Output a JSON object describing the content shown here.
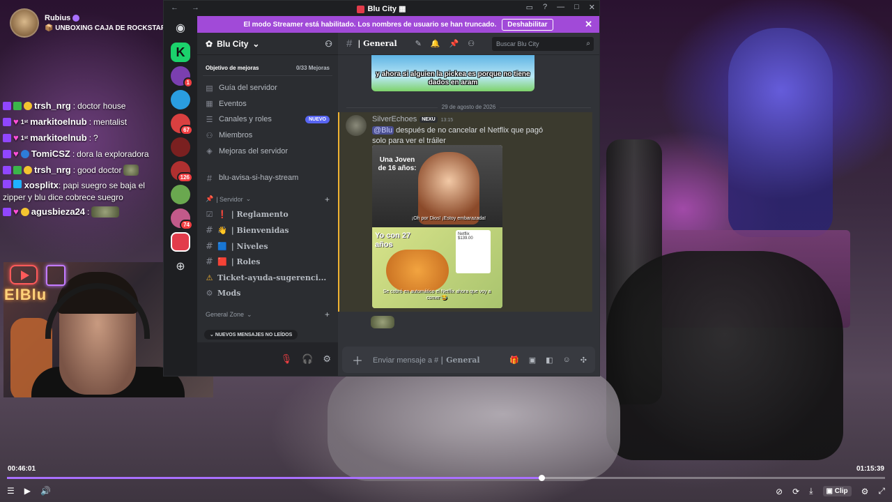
{
  "stream": {
    "streamer_name": "Rubius",
    "stream_title": "📦 UNBOXING CAJA DE ROCKSTAR 📦 N",
    "neon_sign": "ElBlu",
    "time_elapsed": "00:46:01",
    "time_total": "01:15:39",
    "progress": 0.609,
    "clip_label": "Clip"
  },
  "chat": [
    {
      "user": "trsh_nrg",
      "text": "doctor house",
      "user_color": "#ffffff"
    },
    {
      "user": "markitoelnub",
      "text": "mentalist",
      "user_color": "#ffffff"
    },
    {
      "user": "markitoelnub",
      "text": "?",
      "user_color": "#ffffff"
    },
    {
      "user": "TomiCSZ",
      "text": "dora la exploradora",
      "user_color": "#ffffff"
    },
    {
      "user": "trsh_nrg",
      "text": "good doctor",
      "user_color": "#ffffff"
    },
    {
      "user": "xosplitx",
      "text": "papi suegro se baja el zipper y blu dice cobrece suegro",
      "user_color": "#ffffff"
    },
    {
      "user": "agusbieza24",
      "text": "",
      "user_color": "#ffffff"
    }
  ],
  "discord": {
    "window_title": "Blu City",
    "streamer_banner": "El modo Streamer está habilitado. Los nombres de usuario se han truncado.",
    "disable_label": "Deshabilitar",
    "server_name": "Blu City",
    "boost_label": "Objetivo de mejoras",
    "boost_count": "0/33 Mejoras",
    "nav": [
      {
        "label": "Guía del servidor",
        "icon": "guide-icon"
      },
      {
        "label": "Eventos",
        "icon": "calendar-icon"
      },
      {
        "label": "Canales y roles",
        "icon": "channels-roles-icon",
        "badge": "NUEVO"
      },
      {
        "label": "Miembros",
        "icon": "members-icon"
      },
      {
        "label": "Mejoras del servidor",
        "icon": "boost-icon"
      }
    ],
    "loose_channel": "blu-avisa-si-hay-stream",
    "category_server": "| Servidor",
    "channels": [
      {
        "emoji": "❗",
        "name": "| Reglamento",
        "icon": "rules-icon"
      },
      {
        "emoji": "👋",
        "name": "| Bienvenidas",
        "icon": "hash-icon"
      },
      {
        "emoji": "🟦",
        "name": "| Niveles",
        "icon": "hash-icon"
      },
      {
        "emoji": "🟥",
        "name": "| Roles",
        "icon": "hash-icon"
      },
      {
        "emoji": "",
        "name": "Ticket-ayuda-sugerenci...",
        "icon": "warning-icon"
      },
      {
        "emoji": "",
        "name": "Mods",
        "icon": "gear-icon"
      }
    ],
    "category_general": "General Zone",
    "unread_label": "NUEVOS MENSAJES NO LEÍDOS",
    "current_channel": "| General",
    "search_placeholder": "Buscar Blu City",
    "top_image_caption": "y ahora si alguien la pickea es porque no tiene dados en aram",
    "date_divider": "29 de agosto de 2026",
    "message": {
      "author": "SilverEchoes",
      "tag": "NEXU",
      "time": "13:15",
      "mention": "@Blu",
      "text": "después de no cancelar el Netflix que pagó solo para ver el tráiler"
    },
    "meme": {
      "top_text": "Una Joven de 16 años:",
      "top_caption": "¡Oh por Dios! ¡Estoy embarazada!",
      "bottom_text": "Yo con 27 años",
      "bill_title": "Netflix",
      "bill_amount": "$139.00",
      "bottom_caption": "Se cobró en automático el Netflix ahora que voy a comer 😂"
    },
    "composer_placeholder": "Enviar mensaje a #",
    "composer_channel": "| General",
    "guild_badges": [
      "1",
      "67",
      "126",
      "74"
    ]
  },
  "colors": {
    "discord_blurple": "#5865f2",
    "streamer_purple": "#a14ad8",
    "twitch_purple": "#a970ff",
    "highlight": "#f0b232"
  }
}
